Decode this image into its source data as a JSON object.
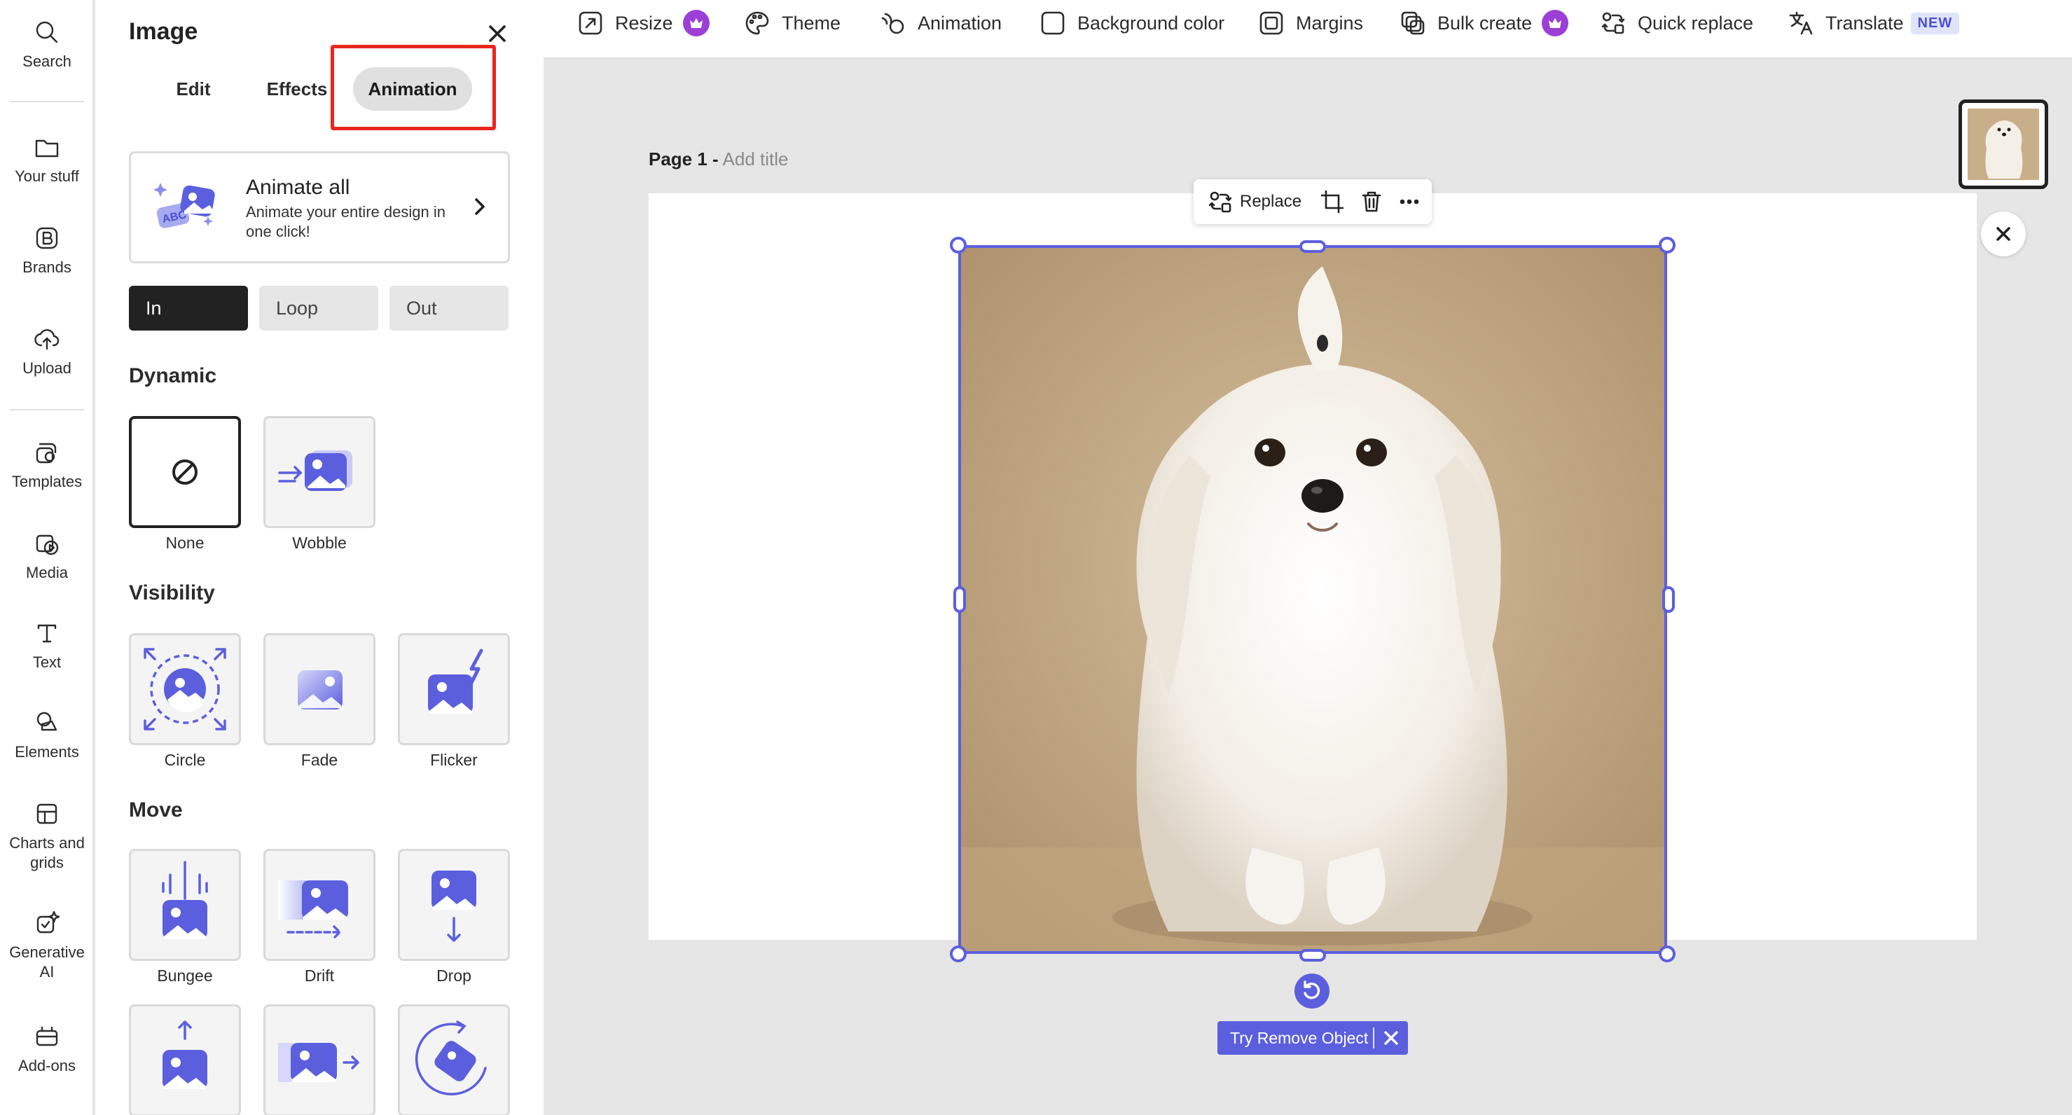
{
  "rail": {
    "items": [
      {
        "label": "Search",
        "icon": "search-icon"
      },
      {
        "label": "Your stuff",
        "icon": "folder-icon"
      },
      {
        "label": "Brands",
        "icon": "brand-icon"
      },
      {
        "label": "Upload",
        "icon": "upload-cloud-icon"
      },
      {
        "label": "Templates",
        "icon": "templates-icon"
      },
      {
        "label": "Media",
        "icon": "media-icon"
      },
      {
        "label": "Text",
        "icon": "text-icon"
      },
      {
        "label": "Elements",
        "icon": "elements-icon"
      },
      {
        "label": "Charts and\ngrids",
        "icon": "charts-grids-icon"
      },
      {
        "label": "Generative\nAI",
        "icon": "generative-ai-icon"
      },
      {
        "label": "Add-ons",
        "icon": "add-ons-icon"
      }
    ]
  },
  "panel": {
    "title": "Image",
    "tabs": [
      "Edit",
      "Effects",
      "Animation"
    ],
    "active_tab": "Animation",
    "animate_all": {
      "title": "Animate all",
      "description": "Animate your entire design in one click!"
    },
    "segments": [
      "In",
      "Loop",
      "Out"
    ],
    "active_segment": "In",
    "sections": [
      {
        "title": "Dynamic",
        "items": [
          "None",
          "Wobble"
        ]
      },
      {
        "title": "Visibility",
        "items": [
          "Circle",
          "Fade",
          "Flicker"
        ]
      },
      {
        "title": "Move",
        "items": [
          "Bungee",
          "Drift",
          "Drop"
        ]
      }
    ],
    "selected_item": "None"
  },
  "toolbar": {
    "items": [
      {
        "label": "Resize",
        "icon": "resize-icon",
        "premium": true
      },
      {
        "label": "Theme",
        "icon": "palette-icon"
      },
      {
        "label": "Animation",
        "icon": "animation-icon"
      },
      {
        "label": "Background color",
        "icon": "background-color-icon"
      },
      {
        "label": "Margins",
        "icon": "margins-icon"
      },
      {
        "label": "Bulk create",
        "icon": "bulk-create-icon",
        "premium": true
      },
      {
        "label": "Quick replace",
        "icon": "quick-replace-icon"
      },
      {
        "label": "Translate",
        "icon": "translate-icon",
        "badge": "NEW"
      }
    ]
  },
  "canvas": {
    "page_label": "Page 1 -",
    "title_placeholder": "Add title",
    "context_bar": {
      "replace_label": "Replace"
    },
    "try_remove_label": "Try Remove Object"
  },
  "colors": {
    "accent": "#5b5fde",
    "premium": "#9b3fd6",
    "highlight": "#e8261e"
  }
}
